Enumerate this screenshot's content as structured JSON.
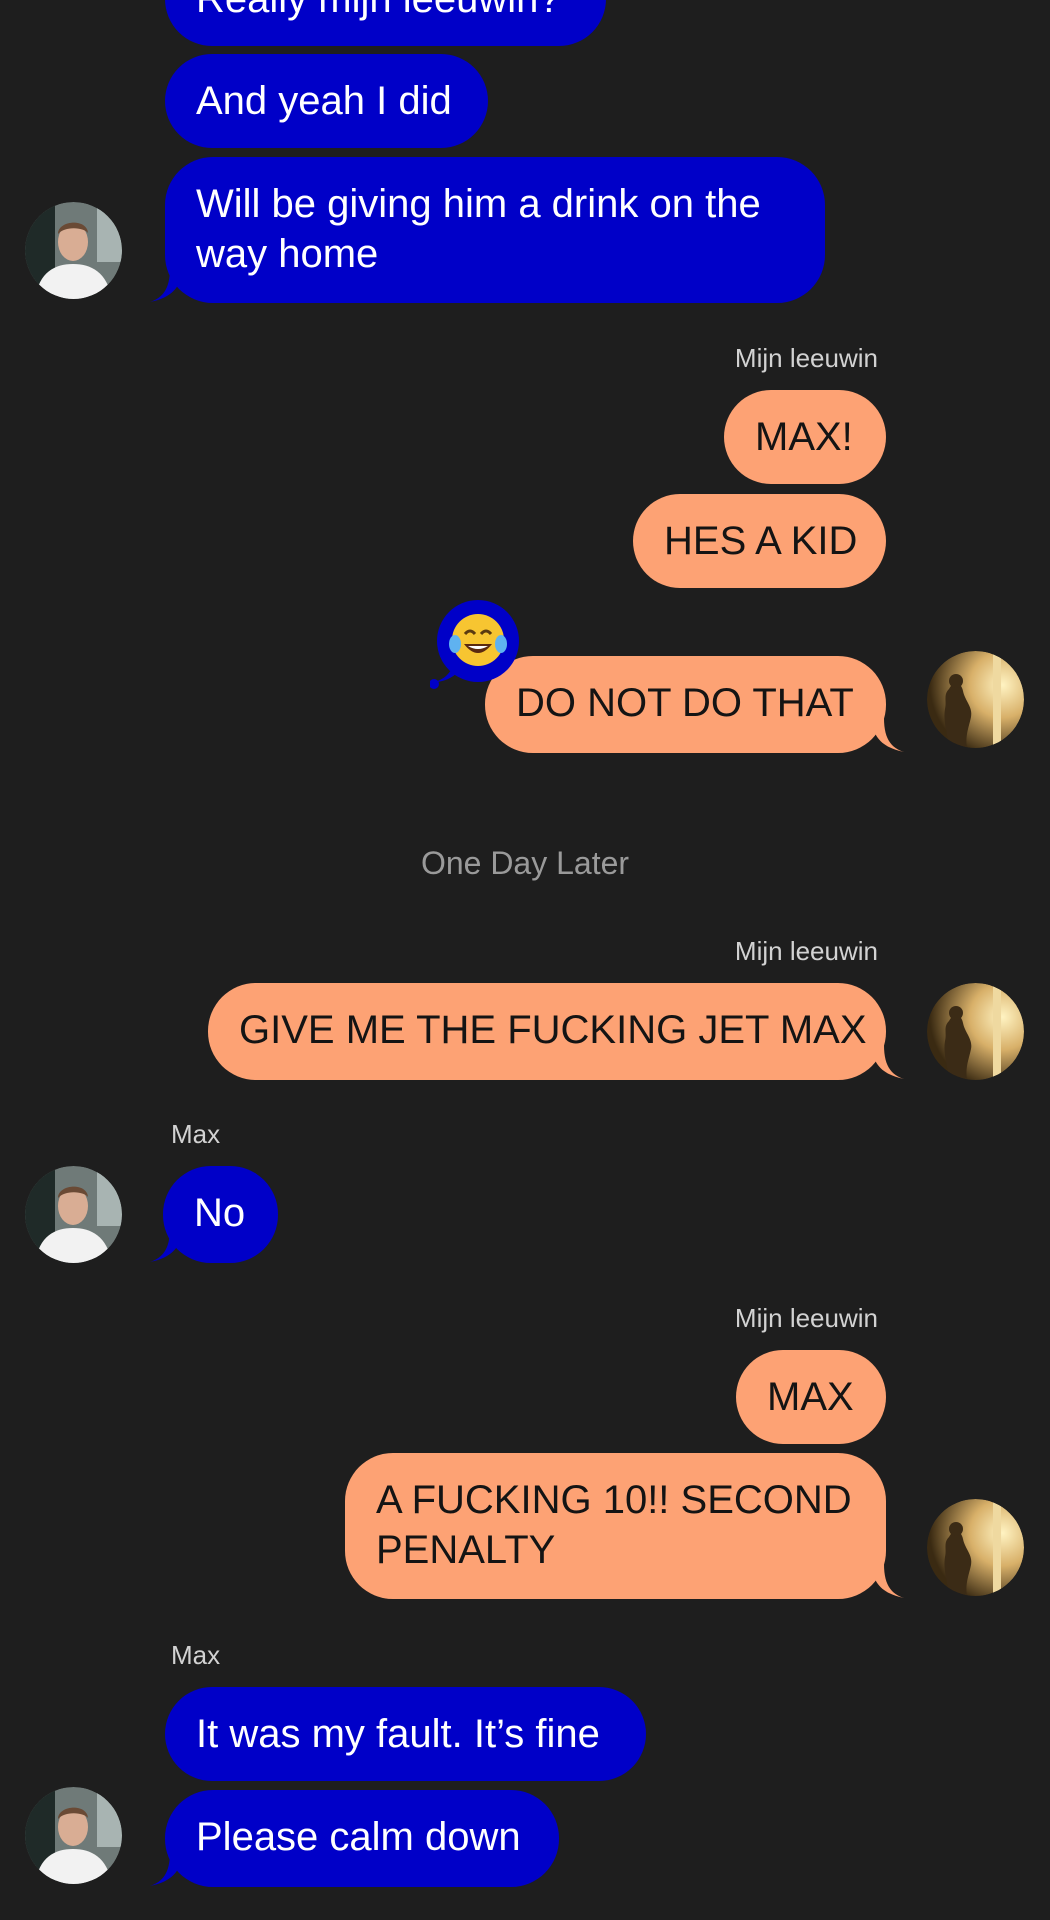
{
  "conversation": {
    "messages": [
      {
        "sender": "Max",
        "text": "Really mijn leeuwin?"
      },
      {
        "sender": "Max",
        "text": "And yeah I did"
      },
      {
        "sender": "Max",
        "text": "Will be giving him a drink on the way home"
      },
      {
        "sender": "Mijn leeuwin",
        "text": "MAX!"
      },
      {
        "sender": "Mijn leeuwin",
        "text": "HES A KID"
      },
      {
        "sender": "Mijn leeuwin",
        "text": "DO NOT DO THAT",
        "reaction": "😂"
      },
      {
        "sender": "Mijn leeuwin",
        "text": "GIVE ME THE FUCKING JET MAX"
      },
      {
        "sender": "Max",
        "text": "No"
      },
      {
        "sender": "Mijn leeuwin",
        "text": "MAX"
      },
      {
        "sender": "Mijn leeuwin",
        "text": "A FUCKING 10!! SECOND PENALTY"
      },
      {
        "sender": "Max",
        "text": "It was my fault. It’s fine"
      },
      {
        "sender": "Max",
        "text": "Please calm down"
      }
    ],
    "sender_labels": [
      "Mijn leeuwin",
      "Mijn leeuwin",
      "Max",
      "Mijn leeuwin",
      "Max"
    ],
    "time_divider": "One Day Later"
  },
  "colors": {
    "background": "#1e1e1e",
    "max_bubble": "#0000c8",
    "leeuwin_bubble": "#fda274",
    "name_label": "#d2d2d2",
    "divider_text": "#9a9a9a"
  },
  "icons": {
    "reaction": "face-with-tears-of-joy-emoji",
    "max_avatar": "max-avatar-photo",
    "leeuwin_avatar": "leeuwin-avatar-photo"
  }
}
